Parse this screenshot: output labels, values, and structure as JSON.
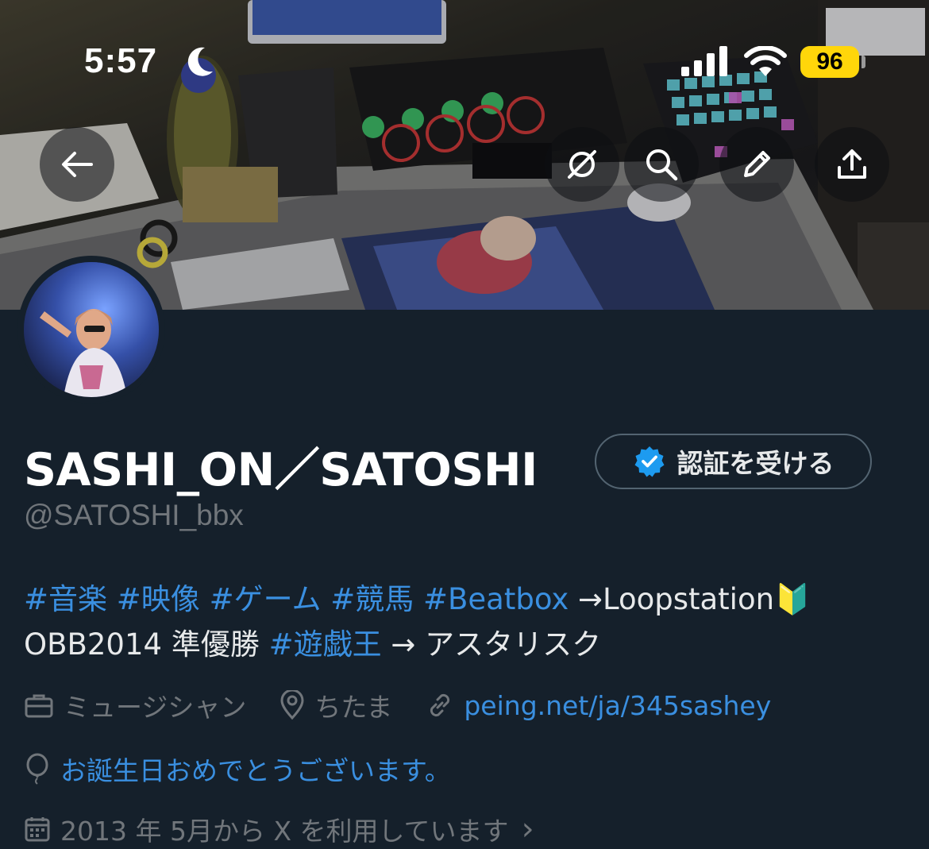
{
  "status_bar": {
    "time": "5:57",
    "battery": "96"
  },
  "header": {
    "back_icon": "arrow-left-icon",
    "actions": [
      "incognito-icon",
      "search-icon",
      "pencil-icon",
      "share-icon"
    ]
  },
  "profile": {
    "display_name": "SASHI_ON／SATOSHI",
    "verify_button_label": "認証を受ける",
    "handle": "@SATOSHI_bbx",
    "bio": {
      "line1": [
        {
          "text": "#音楽",
          "tag": true
        },
        {
          "text": " ",
          "tag": false
        },
        {
          "text": "#映像",
          "tag": true
        },
        {
          "text": " ",
          "tag": false
        },
        {
          "text": "#ゲーム",
          "tag": true
        },
        {
          "text": " ",
          "tag": false
        },
        {
          "text": "#競馬",
          "tag": true
        },
        {
          "text": " ",
          "tag": false
        },
        {
          "text": "#Beatbox",
          "tag": true
        },
        {
          "text": " →Loopstation🔰",
          "tag": false
        }
      ],
      "line2": [
        {
          "text": "OBB2014 準優勝 ",
          "tag": false
        },
        {
          "text": "#遊戯王",
          "tag": true
        },
        {
          "text": " → アスタリスク",
          "tag": false
        }
      ]
    },
    "profession": "ミュージシャン",
    "location": "ちたま",
    "website": "peing.net/ja/345sashey",
    "birthday_text": "お誕生日おめでとうございます。",
    "joined": "2013 年 5月から X を利用しています",
    "joined_chevron": "›"
  },
  "colors": {
    "background": "#15202b",
    "accent_link": "#3a8fe0",
    "verified_badge": "#1d9bf0",
    "muted_text": "#71767b",
    "battery": "#ffd60a"
  }
}
